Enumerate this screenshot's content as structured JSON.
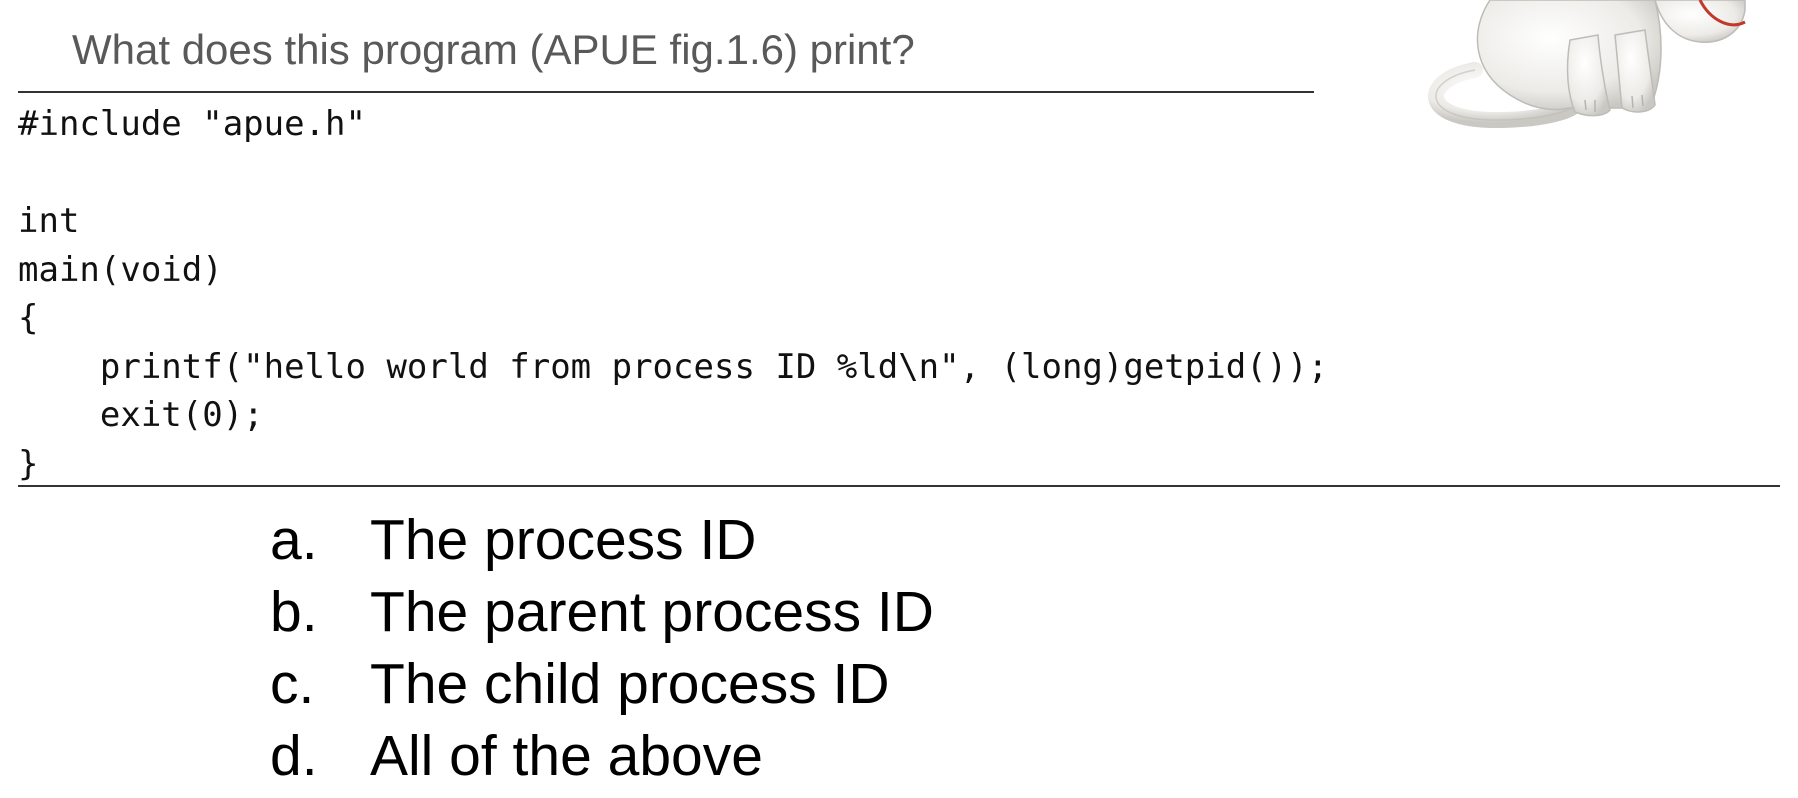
{
  "slide": {
    "question": "What does this program (APUE fig.1.6) print?",
    "code_lines": [
      "#include \"apue.h\"",
      "",
      "int",
      "main(void)",
      "{",
      "    printf(\"hello world from process ID %ld\\n\", (long)getpid());",
      "    exit(0);",
      "}"
    ],
    "options": [
      {
        "letter": "a.",
        "text": "The process ID"
      },
      {
        "letter": "b.",
        "text": "The parent process ID"
      },
      {
        "letter": "c.",
        "text": "The child process ID"
      },
      {
        "letter": "d.",
        "text": "All of the above"
      }
    ]
  },
  "colors": {
    "question_text": "#595959",
    "rule": "#333333",
    "mascot_body": "#ededea",
    "mascot_accent": "#c0392b"
  },
  "icons": {
    "mascot": "cartoon-cat-mascot"
  }
}
